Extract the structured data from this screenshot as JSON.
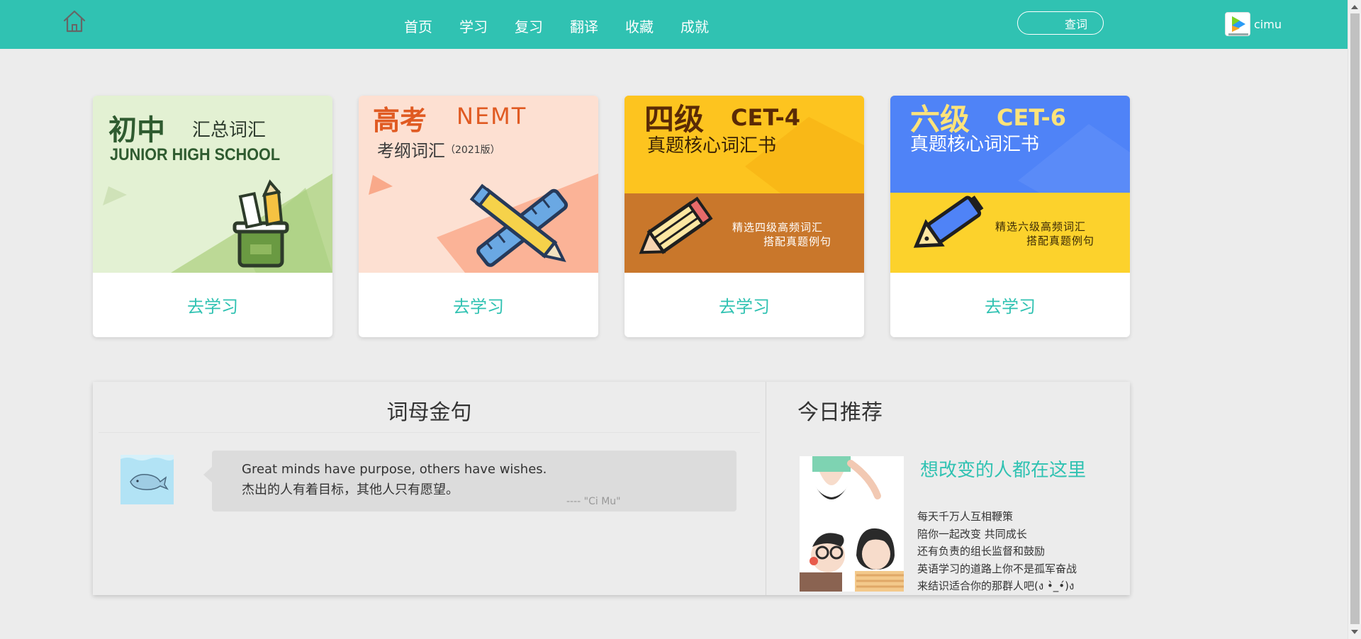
{
  "header": {
    "nav": [
      "首页",
      "学习",
      "复习",
      "翻译",
      "收藏",
      "成就"
    ],
    "search_label": "查词",
    "user_name": "cimu"
  },
  "books": [
    {
      "title_main": "初中",
      "title_sub": "汇总词汇",
      "title_en": "JUNIOR HIGH SCHOOL",
      "action": "去学习"
    },
    {
      "title_main": "高考",
      "title_en": "NEMT",
      "title_sub": "考纲词汇",
      "edition": "（2021版）",
      "action": "去学习"
    },
    {
      "title_main": "四级",
      "title_en": "CET-4",
      "title_sub": "真题核心词汇书",
      "tagline_1": "精选四级高频词汇",
      "tagline_2": "搭配真题例句",
      "action": "去学习"
    },
    {
      "title_main": "六级",
      "title_en": "CET-6",
      "title_sub": "真题核心词汇书",
      "tagline_1": "精选六级高频词汇",
      "tagline_2": "搭配真题例句",
      "action": "去学习"
    }
  ],
  "quote": {
    "title": "词母金句",
    "english": "Great minds have purpose, others have wishes.",
    "chinese": "杰出的人有着目标，其他人只有愿望。",
    "author": "---- \"Ci Mu\""
  },
  "recommend": {
    "title": "今日推荐",
    "headline": "想改变的人都在这里",
    "lines": [
      "每天千万人互相鞭策",
      "陪你一起改变 共同成长",
      "还有负责的组长监督和鼓励",
      "英语学习的道路上你不是孤军奋战",
      "来结识适合你的那群人吧(ง •̀_•́)ง"
    ]
  },
  "colors": {
    "accent": "#30c2b2",
    "background": "#ececec"
  }
}
